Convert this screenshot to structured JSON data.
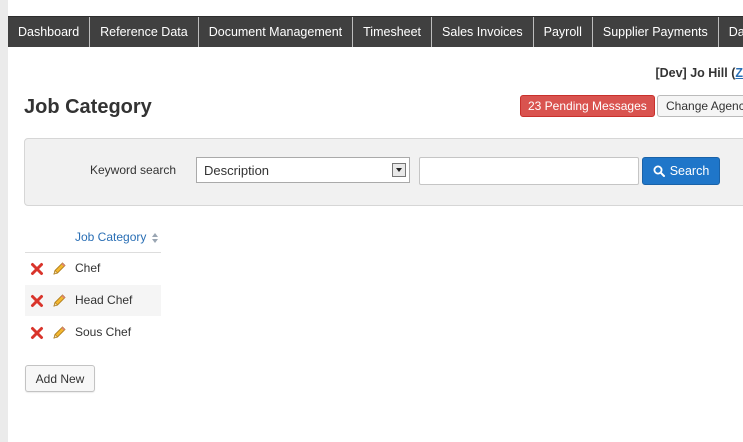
{
  "nav": {
    "items": [
      {
        "label": "Dashboard"
      },
      {
        "label": "Reference Data"
      },
      {
        "label": "Document Management"
      },
      {
        "label": "Timesheet"
      },
      {
        "label": "Sales Invoices"
      },
      {
        "label": "Payroll"
      },
      {
        "label": "Supplier Payments"
      },
      {
        "label": "Data Ex"
      }
    ]
  },
  "user": {
    "env": "[Dev]",
    "name": "Jo Hill",
    "paren_open": "(",
    "link_text": "Z"
  },
  "page": {
    "title": "Job Category"
  },
  "header_actions": {
    "pending_messages": "23 Pending Messages",
    "change_agency": "Change Agenc"
  },
  "search": {
    "label": "Keyword search",
    "field_selected": "Description",
    "input_value": "",
    "button_label": "Search"
  },
  "table": {
    "column_header": "Job Category",
    "rows": [
      {
        "name": "Chef"
      },
      {
        "name": "Head Chef"
      },
      {
        "name": "Sous Chef"
      }
    ]
  },
  "actions": {
    "add_new": "Add New"
  },
  "colors": {
    "nav_bg": "#404040",
    "pending_badge": "#d9534f",
    "search_button": "#1f76c9",
    "link": "#2a6fb5"
  }
}
